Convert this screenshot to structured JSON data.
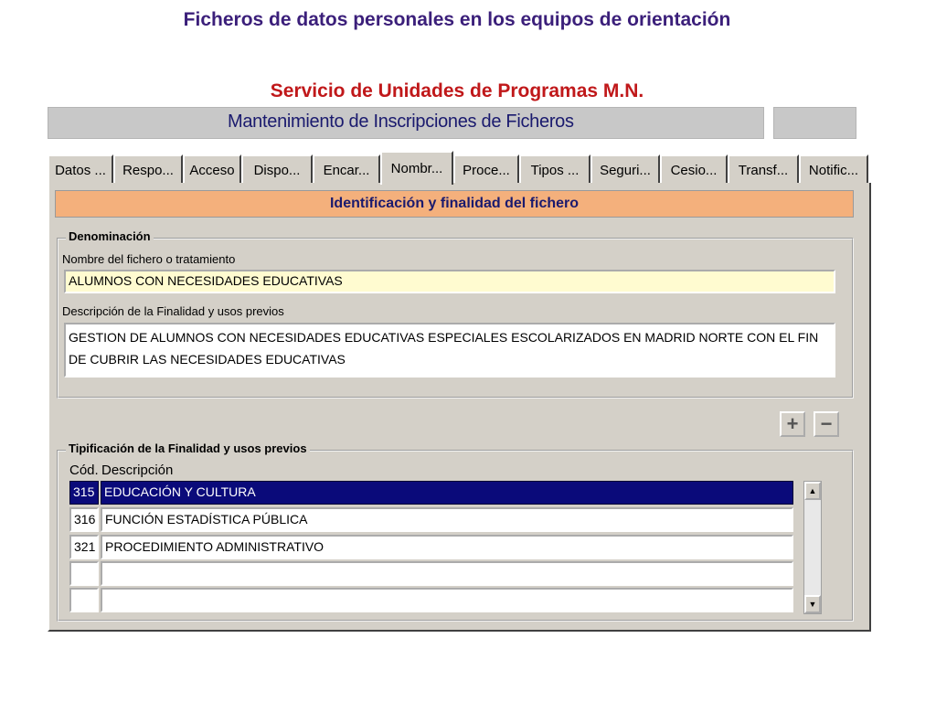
{
  "slide": {
    "title": "Ficheros de datos personales en los equipos de orientación",
    "subtitle": "Servicio de Unidades de Programas M.N."
  },
  "window": {
    "title": "Mantenimiento de Inscripciones de Ficheros"
  },
  "tabs": [
    {
      "label": "Datos ..."
    },
    {
      "label": "Respo..."
    },
    {
      "label": "Acceso"
    },
    {
      "label": "Dispo..."
    },
    {
      "label": "Encar..."
    },
    {
      "label": "Nombr...",
      "active": true
    },
    {
      "label": "Proce..."
    },
    {
      "label": "Tipos ..."
    },
    {
      "label": "Seguri..."
    },
    {
      "label": "Cesio..."
    },
    {
      "label": "Transf..."
    },
    {
      "label": "Notific..."
    }
  ],
  "section": {
    "header": "Identificación y finalidad del fichero"
  },
  "denominacion": {
    "legend": "Denominación",
    "name_label": "Nombre del fichero o tratamiento",
    "name_value": "ALUMNOS CON NECESIDADES EDUCATIVAS",
    "desc_label": "Descripción de la Finalidad y usos previos",
    "desc_value": "GESTION DE ALUMNOS CON  NECESIDADES EDUCATIVAS ESPECIALES ESCOLARIZADOS EN MADRID NORTE CON EL FIN DE CUBRIR LAS NECESIDADES EDUCATIVAS"
  },
  "buttons": {
    "add": "+",
    "remove": "−"
  },
  "tipificacion": {
    "legend": "Tipificación de la Finalidad y usos previos",
    "col_code": "Cód.",
    "col_desc": "Descripción",
    "rows": [
      {
        "code": "315",
        "desc": "EDUCACIÓN Y CULTURA",
        "selected": true
      },
      {
        "code": "316",
        "desc": "FUNCIÓN ESTADÍSTICA PÚBLICA"
      },
      {
        "code": "321",
        "desc": "PROCEDIMIENTO ADMINISTRATIVO"
      },
      {
        "code": "",
        "desc": ""
      },
      {
        "code": "",
        "desc": ""
      }
    ]
  },
  "scroll": {
    "up": "▲",
    "down": "▼"
  }
}
